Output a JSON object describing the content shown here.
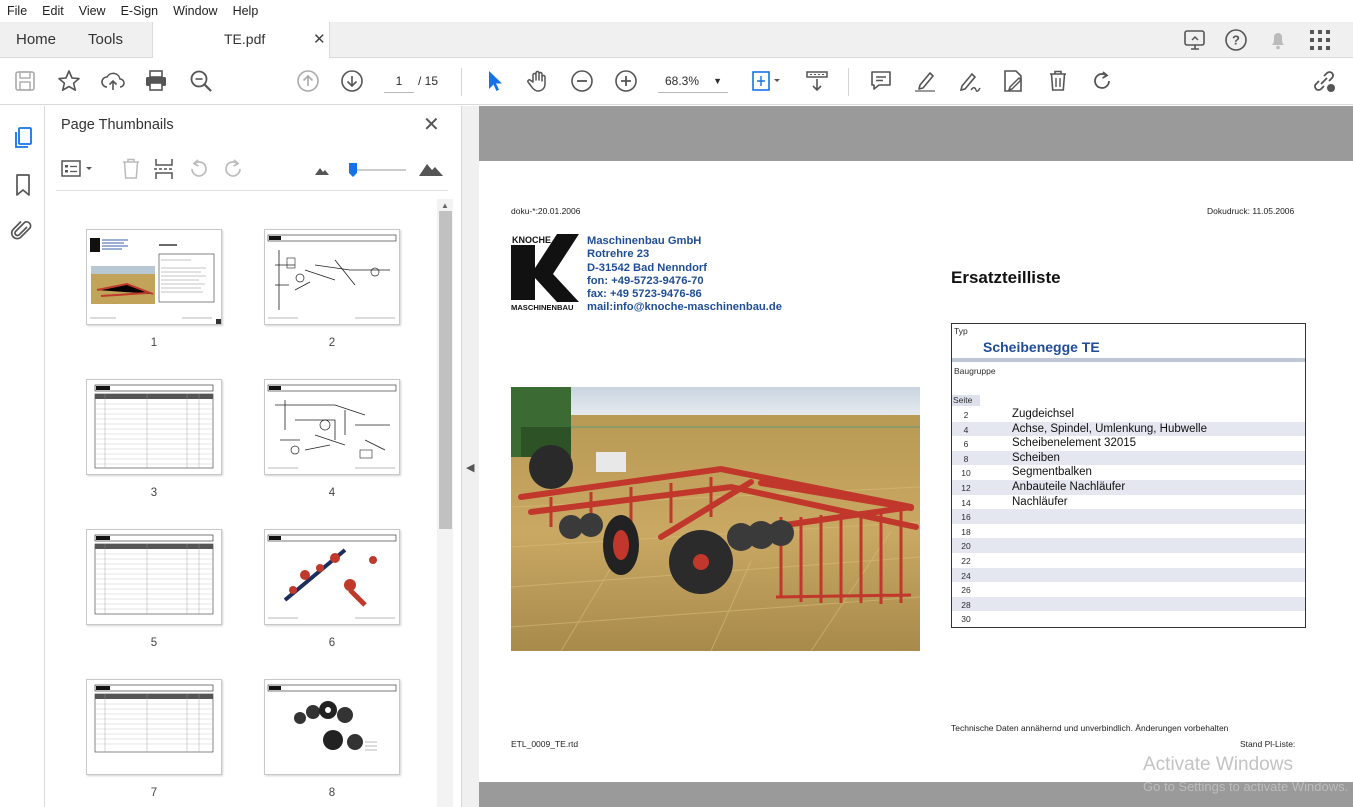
{
  "menu": [
    "File",
    "Edit",
    "View",
    "E-Sign",
    "Window",
    "Help"
  ],
  "tabs": {
    "home": "Home",
    "tools": "Tools",
    "document": "TE.pdf"
  },
  "toolbar": {
    "page_current": "1",
    "page_total": "/ 15",
    "zoom": "68.3%"
  },
  "panel": {
    "title": "Page Thumbnails"
  },
  "thumbnails": [
    {
      "label": "1"
    },
    {
      "label": "2"
    },
    {
      "label": "3"
    },
    {
      "label": "4"
    },
    {
      "label": "5"
    },
    {
      "label": "6"
    },
    {
      "label": "7"
    },
    {
      "label": "8"
    }
  ],
  "page": {
    "doku_left": "doku-*:20.01.2006",
    "doku_right": "Dokudruck: 11.05.2006",
    "logo_top": "KNOCHE",
    "logo_bottom": "MASCHINENBAU",
    "company_lines": [
      "Maschinenbau GmbH",
      "Rotrehre 23",
      "D-31542 Bad Nenndorf",
      "fon: +49-5723-9476-70",
      "fax: +49 5723-9476-86",
      "mail:info@knoche-maschinenbau.de"
    ],
    "heading": "Ersatzteilliste",
    "typ_label": "Typ",
    "typ_value": "Scheibenegge TE",
    "baugruppe_label": "Baugruppe",
    "seite_label": "Seite",
    "rows": [
      {
        "n": "2",
        "d": "Zugdeichsel"
      },
      {
        "n": "4",
        "d": "Achse, Spindel, Umlenkung, Hubwelle"
      },
      {
        "n": "6",
        "d": "Scheibenelement 32015"
      },
      {
        "n": "8",
        "d": "Scheiben"
      },
      {
        "n": "10",
        "d": "Segmentbalken"
      },
      {
        "n": "12",
        "d": "Anbauteile Nachläufer"
      },
      {
        "n": "14",
        "d": "Nachläufer"
      },
      {
        "n": "16",
        "d": ""
      },
      {
        "n": "18",
        "d": ""
      },
      {
        "n": "20",
        "d": ""
      },
      {
        "n": "22",
        "d": ""
      },
      {
        "n": "24",
        "d": ""
      },
      {
        "n": "26",
        "d": ""
      },
      {
        "n": "28",
        "d": ""
      },
      {
        "n": "30",
        "d": ""
      }
    ],
    "disclaimer": "Technische Daten annähernd und unverbindlich. Änderungen vorbehalten",
    "footer_left": "ETL_0009_TE.rtd",
    "footer_right": "Stand Pl-Liste:"
  },
  "watermark": {
    "line1": "Activate Windows",
    "line2": "Go to Settings to activate Windows."
  },
  "colors": {
    "accent": "#1473e6",
    "company_blue": "#1f4e96",
    "viewer_gray": "#9a9a9a"
  }
}
